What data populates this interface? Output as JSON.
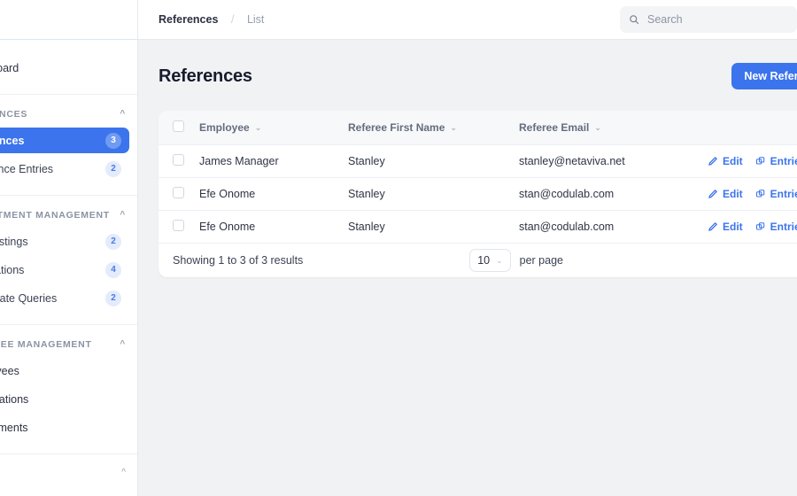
{
  "sidebar": {
    "sections": [
      {
        "label": "",
        "collapse_icon": "chevron-up-icon",
        "items": [
          {
            "label": "Dashboard",
            "badge": ""
          }
        ]
      },
      {
        "label": "REFERENCES",
        "collapse_icon": "chevron-up-icon",
        "items": [
          {
            "label": "References",
            "badge": "3",
            "active": true
          },
          {
            "label": "Reference Entries",
            "badge": "2",
            "active": false
          }
        ]
      },
      {
        "label": "RECRUITMENT MANAGEMENT",
        "collapse_icon": "chevron-up-icon",
        "items": [
          {
            "label": "Job Postings",
            "badge": "2",
            "active": false
          },
          {
            "label": "Applications",
            "badge": "4",
            "active": false
          },
          {
            "label": "Candidate Queries",
            "badge": "2",
            "active": false
          }
        ]
      },
      {
        "label": "EMPLOYEE MANAGEMENT",
        "collapse_icon": "chevron-up-icon",
        "items": [
          {
            "label": "Employees",
            "badge": ""
          },
          {
            "label": "Designations",
            "badge": ""
          },
          {
            "label": "Departments",
            "badge": ""
          }
        ]
      }
    ],
    "footer_collapse_icon": "chevron-up-icon"
  },
  "topbar": {
    "breadcrumb_root": "References",
    "breadcrumb_separator": "/",
    "breadcrumb_current": "List",
    "search_icon": "search-icon",
    "search_value": "",
    "search_placeholder": "Search"
  },
  "page": {
    "title": "References",
    "new_button_label": "New Reference"
  },
  "table": {
    "select_all_checkbox": "",
    "columns": [
      {
        "label": "Employee",
        "sort_icon": "chevron-down-icon"
      },
      {
        "label": "Referee First Name",
        "sort_icon": "chevron-down-icon"
      },
      {
        "label": "Referee Email",
        "sort_icon": "chevron-down-icon"
      }
    ],
    "rows": [
      {
        "employee": "James Manager",
        "referee_first_name": "Stanley",
        "referee_email": "stanley@netaviva.net",
        "edit_label": "Edit",
        "edit_icon": "pencil-icon",
        "entries_label": "Entries",
        "entries_icon": "layers-icon"
      },
      {
        "employee": "Efe Onome",
        "referee_first_name": "Stanley",
        "referee_email": "stan@codulab.com",
        "edit_label": "Edit",
        "edit_icon": "pencil-icon",
        "entries_label": "Entries",
        "entries_icon": "layers-icon"
      },
      {
        "employee": "Efe Onome",
        "referee_first_name": "Stanley",
        "referee_email": "stan@codulab.com",
        "edit_label": "Edit",
        "edit_icon": "pencil-icon",
        "entries_label": "Entries",
        "entries_icon": "layers-icon"
      }
    ],
    "footer": {
      "results_text": "Showing 1 to 3 of 3 results",
      "per_page_value": "10",
      "per_page_chevron": "chevron-down-icon",
      "per_page_label": "per page"
    }
  },
  "colors": {
    "accent": "#3b74ec",
    "badge_bg": "#e4ebfb",
    "badge_text": "#4a7ae8",
    "page_bg": "#f1f2f4",
    "card_bg": "#ffffff",
    "title_text": "#161c2d"
  }
}
